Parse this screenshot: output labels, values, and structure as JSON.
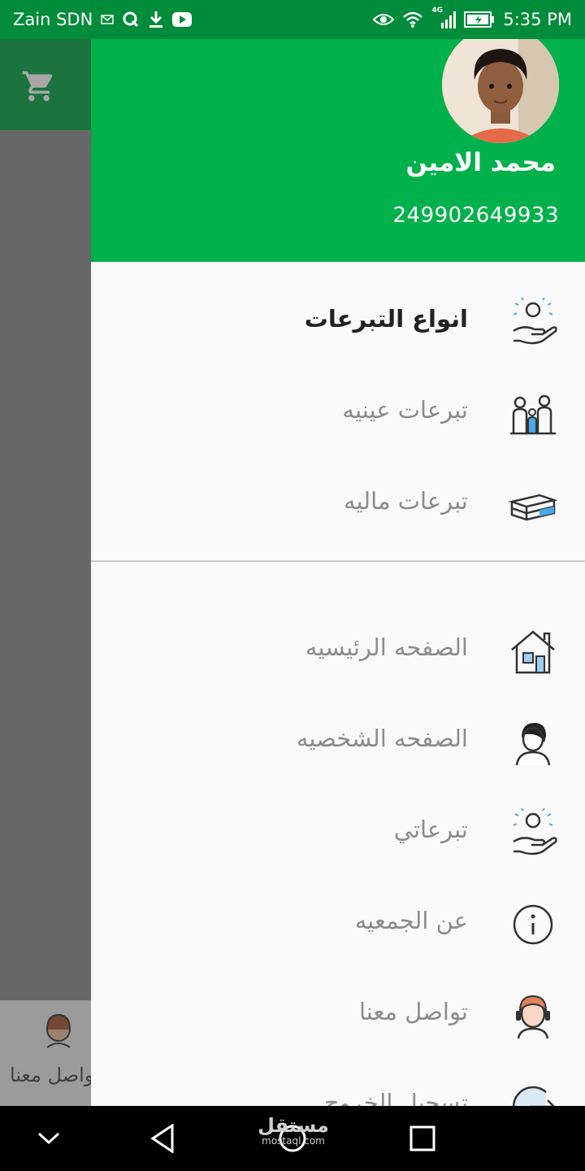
{
  "status_bar": {
    "carrier": "Zain SDN",
    "time": "5:35 PM",
    "left_icons": [
      "gmail-icon",
      "q-app-icon",
      "download-icon",
      "youtube-icon"
    ],
    "right_icons": [
      "eye-icon",
      "wifi-icon",
      "signal-4g-icon",
      "battery-charging-icon"
    ],
    "network_label": "4G"
  },
  "drawer": {
    "user": {
      "name": "محمد  الامين",
      "phone": "249902649933"
    },
    "sections": {
      "donation_types": {
        "header": "انواع التبرعات",
        "items": [
          {
            "label": "تبرعات عينيه",
            "icon": "family-icon"
          },
          {
            "label": "تبرعات ماليه",
            "icon": "money-stack-icon"
          }
        ]
      },
      "main_menu": [
        {
          "label": "الصفحه الرئيسيه",
          "icon": "home-icon"
        },
        {
          "label": "الصفحه الشخصيه",
          "icon": "user-icon"
        },
        {
          "label": "تبرعاتي",
          "icon": "donation-hand-icon"
        },
        {
          "label": "عن الجمعيه",
          "icon": "info-icon"
        },
        {
          "label": "تواصل معنا",
          "icon": "support-agent-icon"
        },
        {
          "label": "تسجيل الخروج",
          "icon": "logout-icon"
        }
      ]
    }
  },
  "background": {
    "bottom_nav_label": "تواصل معنا"
  },
  "watermark": {
    "arabic": "مستقل",
    "latin": "mostaql.com"
  },
  "colors": {
    "primary_green": "#00b14b",
    "status_green": "#008c3a",
    "icon_blue": "#4aa8e8"
  }
}
